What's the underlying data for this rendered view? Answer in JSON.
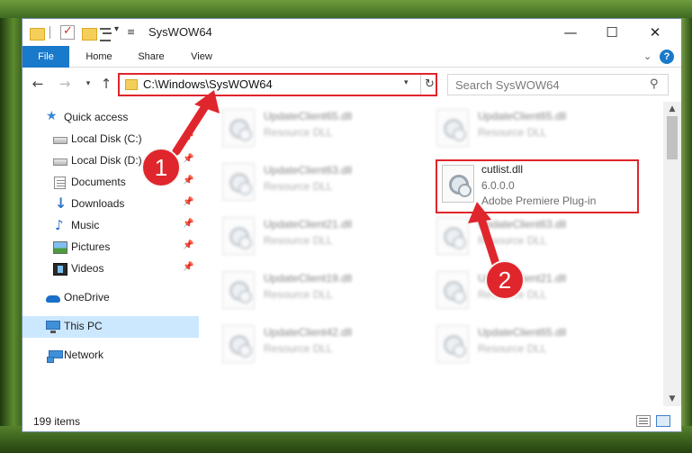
{
  "window": {
    "title": "SysWOW64",
    "minimize_glyph": "—",
    "maximize_glyph": "☐",
    "close_glyph": "✕"
  },
  "ribbon": {
    "tabs": [
      "File",
      "Home",
      "Share",
      "View"
    ],
    "help_label": "?"
  },
  "address_bar": {
    "path": "C:\\Windows\\SysWOW64"
  },
  "search": {
    "placeholder": "Search SysWOW64"
  },
  "sidebar": {
    "items": [
      {
        "label": "Quick access",
        "icon": "star-icon"
      },
      {
        "label": "Local Disk (C:)",
        "icon": "disk-icon",
        "pinned": true
      },
      {
        "label": "Local Disk (D:)",
        "icon": "disk-icon",
        "pinned": true
      },
      {
        "label": "Documents",
        "icon": "documents-icon",
        "pinned": true
      },
      {
        "label": "Downloads",
        "icon": "downloads-icon",
        "pinned": true
      },
      {
        "label": "Music",
        "icon": "music-icon",
        "pinned": true
      },
      {
        "label": "Pictures",
        "icon": "pictures-icon",
        "pinned": true
      },
      {
        "label": "Videos",
        "icon": "videos-icon",
        "pinned": true
      },
      {
        "label": "OneDrive",
        "icon": "onedrive-icon"
      },
      {
        "label": "This PC",
        "icon": "this-pc-icon",
        "selected": true
      },
      {
        "label": "Network",
        "icon": "network-icon"
      }
    ]
  },
  "files": {
    "left_column": [
      {
        "name": "UpdateClient65.dll",
        "desc": "Resource DLL"
      },
      {
        "name": "UpdateClient63.dll",
        "desc": "Resource DLL"
      },
      {
        "name": "UpdateClient21.dll",
        "desc": "Resource DLL"
      },
      {
        "name": "UpdateClient19.dll",
        "desc": "Resource DLL"
      },
      {
        "name": "UpdateClient42.dll",
        "desc": "Resource DLL"
      }
    ],
    "right_column": [
      {
        "name": "UpdateClient65.dll",
        "desc": "Resource DLL"
      },
      {
        "name": "cutlist.dll",
        "desc": "6.0.0.0",
        "desc2": "Adobe Premiere Plug-in",
        "highlighted": true
      },
      {
        "name": "UpdateClient63.dll",
        "desc": "Resource DLL"
      },
      {
        "name": "UpdateClient21.dll",
        "desc": "Resource DLL"
      },
      {
        "name": "UpdateClient65.dll",
        "desc": "Resource DLL"
      }
    ]
  },
  "status": {
    "item_count": "199 items"
  },
  "callouts": {
    "one": "1",
    "two": "2"
  },
  "colors": {
    "accent": "#1979ca",
    "highlight": "#e0242b",
    "selected_bg": "#cce8ff"
  }
}
